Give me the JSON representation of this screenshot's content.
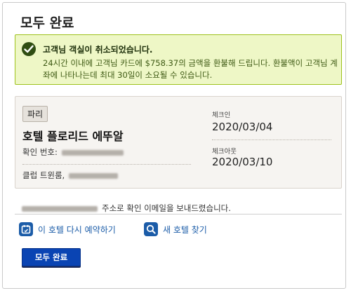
{
  "page": {
    "title": "모두 완료"
  },
  "alert": {
    "heading": "고객님 객실이 취소되었습니다.",
    "message": "24시간 이내에 고객님 카드에 $758.37의 금액을 환불해 드립니다. 환불액이 고객님 계좌에 나타나는데 최대 30일이 소요될 수 있습니다.",
    "icon": "check-circle-icon",
    "colors": {
      "background": "#eef7c6",
      "border": "#9ec21d"
    }
  },
  "booking": {
    "city": "파리",
    "hotel_name": "호텔 플로리드 에뚜알",
    "confirmation_label": "확인 번호:",
    "member_label": "클럽 트윈룸,",
    "checkin_label": "체크인",
    "checkin_date": "2020/03/04",
    "checkout_label": "체크아웃",
    "checkout_date": "2020/03/10"
  },
  "email_notice": "주소로 확인 이메일을 보내드렸습니다.",
  "actions": {
    "rebook_label": "이 호텔 다시 예약하기",
    "find_label": "새 호텔 찾기"
  },
  "done_button": "모두 완료",
  "colors": {
    "accent": "#1b5ca8",
    "button": "#0a44b3"
  }
}
